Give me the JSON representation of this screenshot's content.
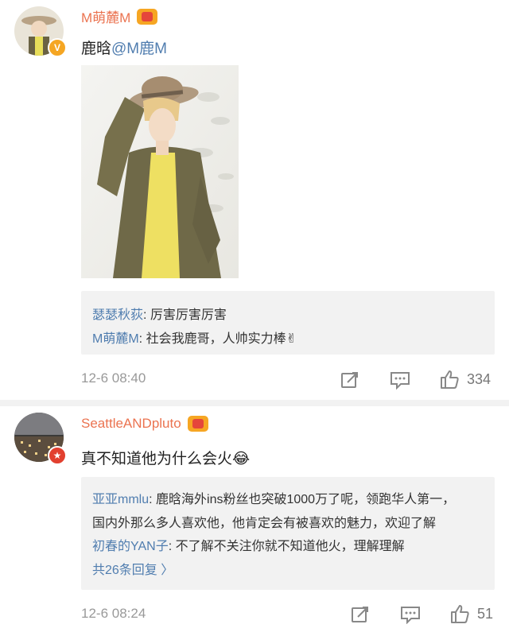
{
  "posts": [
    {
      "username": "M萌麓M",
      "text_prefix": "鹿晗",
      "mention": "@M鹿M",
      "comments": [
        {
          "name": "瑟瑟秋荻",
          "sep": ": ",
          "text": "厉害厉害厉害"
        },
        {
          "name": "M萌麓M",
          "sep": ": ",
          "text": "社会我鹿哥，人帅实力棒✌"
        }
      ],
      "time": "12-6 08:40",
      "likes": "334",
      "badge_color": "#f5a623"
    },
    {
      "username": "SeattleANDpluto",
      "text": "真不知道他为什么会火😂",
      "comments": [
        {
          "name": "亚亚mmlu",
          "sep": ": ",
          "text": "鹿晗海外ins粉丝也突破1000万了呢，领跑华人第一，"
        },
        {
          "name": "",
          "sep": "",
          "text": "国内外那么多人喜欢他，他肯定会有被喜欢的魅力，欢迎了解"
        },
        {
          "name": "初春的YAN子",
          "sep": ": ",
          "text": "不了解不关注你就不知道他火，理解理解"
        }
      ],
      "more": "共26条回复 〉",
      "time": "12-6 08:24",
      "likes": "51",
      "badge_color": "#e2402f"
    }
  ],
  "icons": {
    "repost": "repost-icon",
    "comment": "comment-icon",
    "like": "like-icon"
  }
}
